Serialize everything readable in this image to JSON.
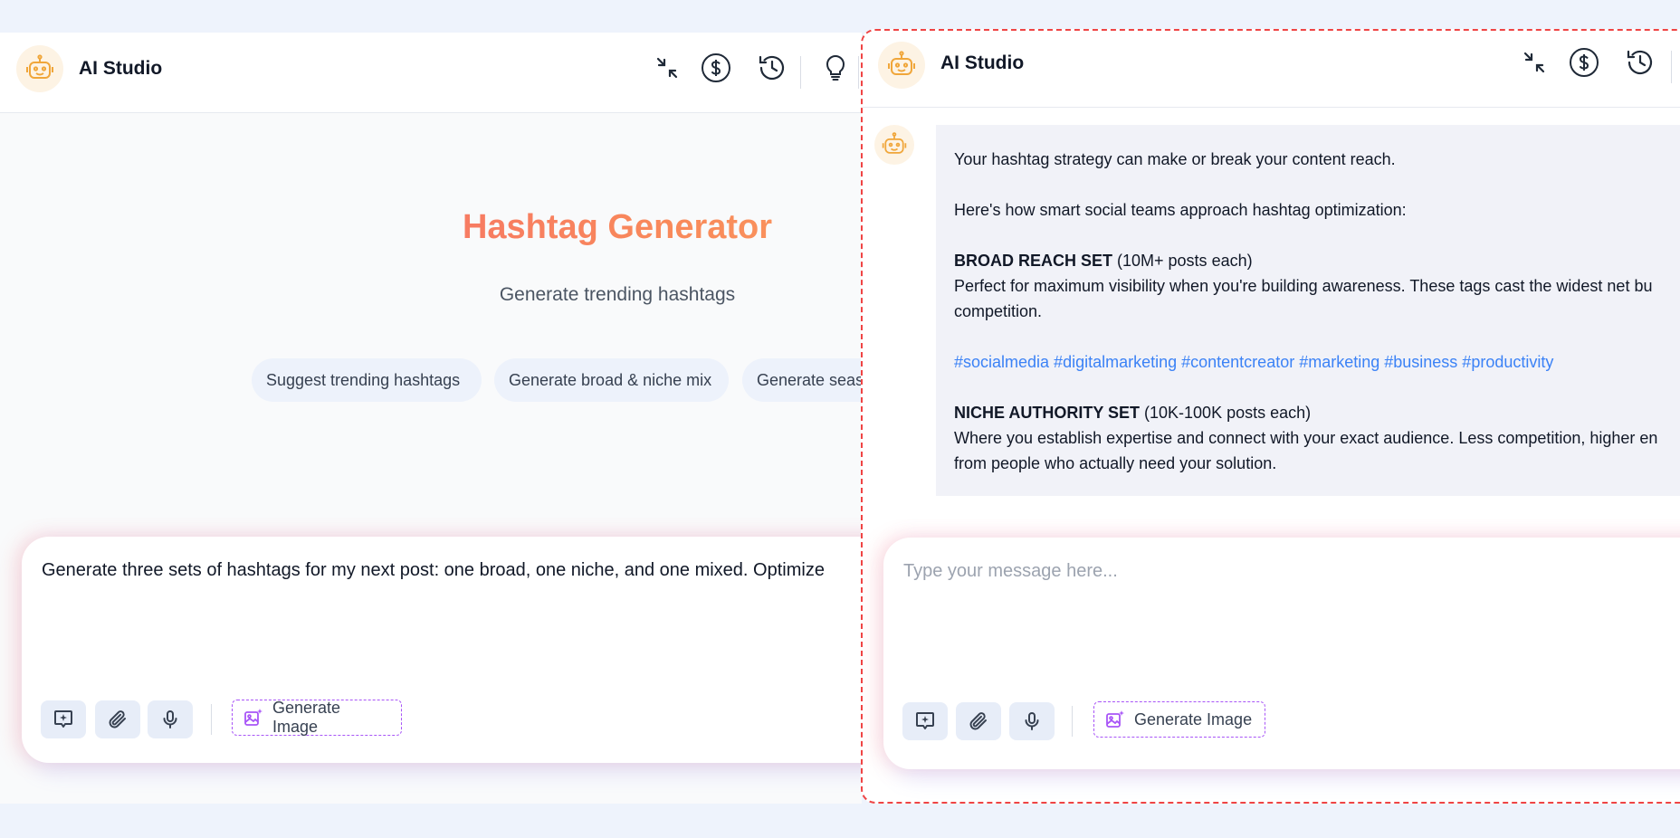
{
  "left": {
    "app_title": "AI Studio",
    "header_icons": [
      "minimize-icon",
      "dollar-icon",
      "history-icon",
      "lightbulb-icon"
    ],
    "hero_title": "Hashtag Generator",
    "hero_subtitle": "Generate trending hashtags",
    "suggestions": [
      "Suggest trending hashtags",
      "Generate broad & niche mix",
      "Generate seas"
    ],
    "input_text": "Generate three sets of hashtags for my next post: one broad, one niche, and one mixed. Optimize",
    "generate_image_label": "Generate Image"
  },
  "right": {
    "app_title": "AI Studio",
    "header_icons": [
      "minimize-icon",
      "dollar-icon",
      "history-icon"
    ],
    "message": {
      "intro": "Your hashtag strategy can make or break your content reach.",
      "lead": "Here's how smart social teams approach hashtag optimization:",
      "broad_title": "BROAD REACH SET",
      "broad_meta": " (10M+ posts each)",
      "broad_desc_1": "Perfect for maximum visibility when you're building awareness. These tags cast the widest net bu",
      "broad_desc_2": "competition.",
      "broad_tags": "#socialmedia #digitalmarketing #contentcreator #marketing #business #productivity",
      "niche_title": "NICHE AUTHORITY SET",
      "niche_meta": " (10K-100K posts each)",
      "niche_desc_1": "Where you establish expertise and connect with your exact audience. Less competition, higher en",
      "niche_desc_2": "from people who actually need your solution."
    },
    "input_placeholder": "Type your message here...",
    "generate_image_label": "Generate Image"
  },
  "colors": {
    "accent_gradient_start": "#f25c74",
    "accent_gradient_end": "#fbb26a",
    "hashtag_link": "#3b82f6",
    "dashed_border": "#ef4444",
    "generate_image_border": "#a855f7"
  }
}
